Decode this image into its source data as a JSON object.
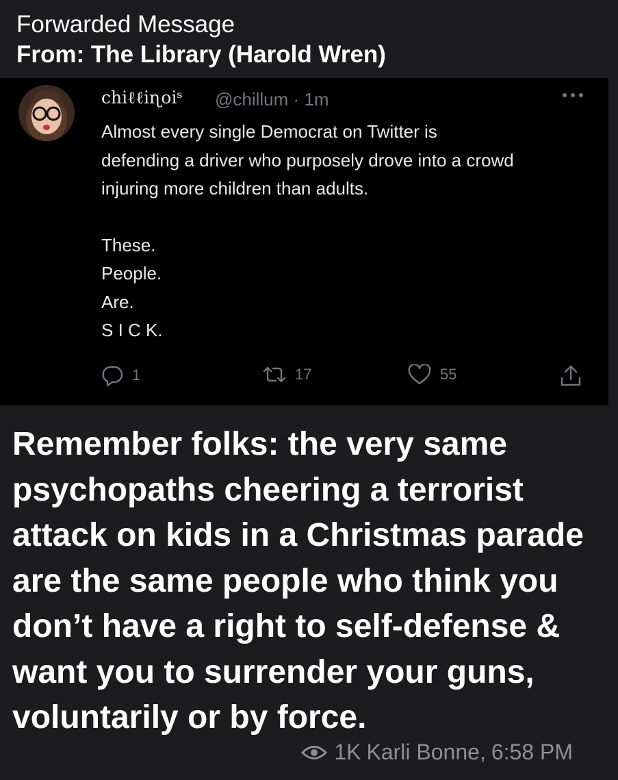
{
  "forward": {
    "line1": "Forwarded Message",
    "line2": "From: The Library (Harold Wren)"
  },
  "tweet": {
    "display_name": "chiℓℓiɳoiˢ",
    "handle_time": "@chillum · 1m",
    "body_lines": [
      "Almost every single Democrat on Twitter is",
      "defending a driver who purposely drove into a crowd",
      "injuring more children than adults."
    ],
    "emphasis_lines": [
      "These.",
      "People.",
      "Are.",
      "S I C K."
    ],
    "replies": "1",
    "retweets": "17",
    "likes": "55",
    "icons": [
      "reply-icon",
      "retweet-icon",
      "like-icon",
      "share-icon",
      "more-icon"
    ]
  },
  "caption": {
    "text": "Remember folks: the very same psychopaths cheering a terrorist attack on kids in a Christmas parade are the same people who think you don’t have a right to self-defense & want you to surrender your guns, voluntarily or by force."
  },
  "meta": {
    "views": "1K",
    "author": "Karli Bonne,",
    "time": "6:58 PM"
  },
  "colors": {
    "bubble_bg": "#1c1c1e",
    "tweet_bg": "#000000",
    "muted": "#71767b",
    "meta": "#8e8e93"
  }
}
